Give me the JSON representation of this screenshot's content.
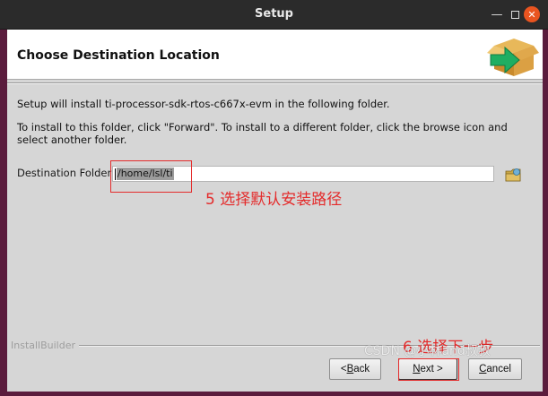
{
  "window": {
    "title": "Setup"
  },
  "header": {
    "title": "Choose Destination Location"
  },
  "body": {
    "line1": "Setup will install ti-processor-sdk-rtos-c667x-evm in the following folder.",
    "line2": "To install to this folder, click \"Forward\". To install to a different folder, click the browse icon and select another folder."
  },
  "destination": {
    "label": "Destination Folder",
    "value": "/home/lsl/ti"
  },
  "footer": {
    "brand": "InstallBuilder"
  },
  "buttons": {
    "back_prefix": "< ",
    "back_key": "B",
    "back_rest": "ack",
    "next_prefix": "",
    "next_key": "N",
    "next_rest": "ext >",
    "cancel_prefix": "",
    "cancel_key": "C",
    "cancel_rest": "ancel"
  },
  "annotations": {
    "step5": "5 选择默认安装路径",
    "step6": "6 选择下一步"
  },
  "watermark": "CSDN @小林and叔叔",
  "colors": {
    "accent_red": "#e42b2b",
    "close_button": "#e95420",
    "titlebar": "#2b2b2b"
  }
}
